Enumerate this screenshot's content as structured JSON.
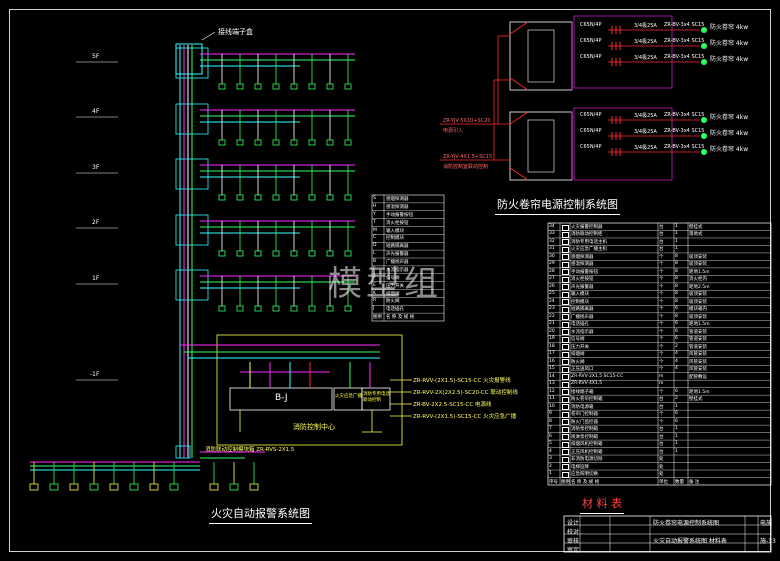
{
  "watermark": "模型组",
  "titles": {
    "fire_alarm_system": "火灾自动报警系统图",
    "fire_door_power": "防火卷帘电源控制系统图",
    "materials_table": "材 料 表"
  },
  "labels": {
    "top_riser": "接线端子盒",
    "control_center": "消防控制中心",
    "bj_box": "B-J",
    "broadcast_unit": "火灾应急广播",
    "telephone_unit": "消防专用电话 联动控制",
    "riser_bottom": "消防联动控制模块箱 ZR-RVS-2X1.5",
    "cable_1": "ZR-RVV-(2X1.5)-SC15-CC 火灾报警线",
    "cable_2": "ZR-RVV-2X(2X2.5)-SC20-CC 联动控制线",
    "cable_3": "ZR-BV-2X2.5-SC15-CC 电源线",
    "cable_4": "ZR-RVV-(2X1.5)-SC15-CC 火灾应急广播",
    "door_cable_1": "ZR-YJV-5X10+SC20",
    "door_cable_2": "ZR-YJV-4X1.5+SC15",
    "door_note_1": "电源引入",
    "door_note_2": "消防控制室联动控制"
  },
  "floors": [
    "5F",
    "4F",
    "3F",
    "2F",
    "1F",
    "-1F"
  ],
  "door_circuits": [
    {
      "breaker": "C65N/4P",
      "rating": "3/4极25A",
      "cable": "ZR-BV-3x4 SC15",
      "load": "防火卷帘 4kw"
    },
    {
      "breaker": "C65N/4P",
      "rating": "3/4极25A",
      "cable": "ZR-BV-3x4 SC15",
      "load": "防火卷帘 4kw"
    },
    {
      "breaker": "C65N/4P",
      "rating": "3/4极25A",
      "cable": "ZR-BV-3x4 SC15",
      "load": "防火卷帘 4kw"
    },
    {
      "breaker": "C65N/4P",
      "rating": "3/4极25A",
      "cable": "ZR-BV-3x4 SC15",
      "load": "防火卷帘 4kw"
    },
    {
      "breaker": "C65N/4P",
      "rating": "3/4极25A",
      "cable": "ZR-BV-3x4 SC15",
      "load": "防火卷帘 4kw"
    },
    {
      "breaker": "C65N/4P",
      "rating": "3/4极25A",
      "cable": "ZR-BV-3x4 SC15",
      "load": "防火卷帘 4kw"
    }
  ],
  "legend_rows": [
    {
      "sym": "S",
      "name": "感烟探测器"
    },
    {
      "sym": "H",
      "name": "感温探测器"
    },
    {
      "sym": "Y",
      "name": "手动报警按钮"
    },
    {
      "sym": "T",
      "name": "消火栓按钮"
    },
    {
      "sym": "M",
      "name": "输入模块"
    },
    {
      "sym": "C",
      "name": "控制模块"
    },
    {
      "sym": "D",
      "name": "短路隔离器"
    },
    {
      "sym": "L",
      "name": "声光报警器"
    },
    {
      "sym": "B",
      "name": "广播扬声器"
    },
    {
      "sym": "F",
      "name": "水流指示器"
    },
    {
      "sym": "P",
      "name": "信号阀"
    },
    {
      "sym": "E",
      "name": "压力开关"
    },
    {
      "sym": "K",
      "name": "排烟阀"
    },
    {
      "sym": "R",
      "name": "防火阀"
    },
    {
      "sym": "J",
      "name": "电话插孔"
    },
    {
      "sym": "图例",
      "name": "名 称 及 规 格"
    }
  ],
  "materials": {
    "header": [
      "序号",
      "图例",
      "名 称 及 规 格",
      "单位",
      "数量",
      "备 注"
    ],
    "rows": [
      [
        "34",
        "",
        "火灾报警控制器",
        "台",
        "1",
        "壁挂式"
      ],
      [
        "33",
        "",
        "消防联动控制柜",
        "台",
        "1",
        "落地式"
      ],
      [
        "32",
        "",
        "消防专用电话主机",
        "台",
        "1",
        ""
      ],
      [
        "31",
        "",
        "火灾应急广播主机",
        "台",
        "1",
        ""
      ],
      [
        "30",
        "",
        "感烟探测器",
        "个",
        "8",
        "吸顶安装"
      ],
      [
        "29",
        "",
        "感温探测器",
        "个",
        "8",
        "吸顶安装"
      ],
      [
        "28",
        "",
        "手动报警按钮",
        "个",
        "8",
        "距地1.5m"
      ],
      [
        "27",
        "",
        "消火栓按钮",
        "个",
        "8",
        "消火栓内"
      ],
      [
        "26",
        "",
        "声光报警器",
        "个",
        "8",
        "距地2.5m"
      ],
      [
        "25",
        "",
        "输入模块",
        "个",
        "8",
        "吸顶安装"
      ],
      [
        "24",
        "",
        "控制模块",
        "个",
        "8",
        "吸顶安装"
      ],
      [
        "23",
        "",
        "短路隔离器",
        "个",
        "6",
        "模块箱内"
      ],
      [
        "22",
        "",
        "广播扬声器",
        "个",
        "8",
        "吸顶安装"
      ],
      [
        "21",
        "",
        "电话插孔",
        "个",
        "6",
        "距地1.5m"
      ],
      [
        "20",
        "",
        "水流指示器",
        "个",
        "6",
        "管道安装"
      ],
      [
        "19",
        "",
        "信号阀",
        "个",
        "6",
        "管道安装"
      ],
      [
        "18",
        "",
        "压力开关",
        "个",
        "2",
        "管道安装"
      ],
      [
        "17",
        "",
        "排烟阀",
        "个",
        "4",
        "风管安装"
      ],
      [
        "16",
        "",
        "防火阀",
        "个",
        "4",
        "风管安装"
      ],
      [
        "15",
        "",
        "正压送风口",
        "个",
        "4",
        "风管安装"
      ],
      [
        "14",
        "",
        "ZR-RVV-2X1.5 SC15-CC",
        "m",
        "",
        "配管敷设"
      ],
      [
        "13",
        "",
        "ZR-RVV-4X1.5",
        "m",
        "",
        ""
      ],
      [
        "12",
        "",
        "接线端子箱",
        "个",
        "6",
        "距地1.5m"
      ],
      [
        "11",
        "",
        "防火卷帘控制箱",
        "台",
        "2",
        "壁挂式"
      ],
      [
        "10",
        "",
        "消防电源箱",
        "台",
        "1",
        ""
      ],
      [
        "9",
        "",
        "卷帘门控制器",
        "个",
        "6",
        ""
      ],
      [
        "8",
        "",
        "防火门监控器",
        "个",
        "6",
        ""
      ],
      [
        "7",
        "",
        "消防泵控制箱",
        "台",
        "1",
        ""
      ],
      [
        "6",
        "",
        "喷淋泵控制箱",
        "台",
        "1",
        ""
      ],
      [
        "5",
        "",
        "排烟风机控制箱",
        "台",
        "1",
        ""
      ],
      [
        "4",
        "",
        "正压风机控制箱",
        "台",
        "1",
        ""
      ],
      [
        "3",
        "",
        "非消防电源切除",
        "处",
        "",
        ""
      ],
      [
        "2",
        "",
        "电梯迫降",
        "处",
        "",
        ""
      ],
      [
        "1",
        "",
        "应急照明切换",
        "处",
        "",
        ""
      ]
    ],
    "footer": [
      "序号",
      "图例",
      "名 称 及 规 格",
      "单位",
      "数量",
      "备 注"
    ]
  },
  "title_block": {
    "project": "防火卷帘电源控制系统图",
    "drawing": "火灾自动报警系统图 材料表",
    "sheet": "电施",
    "no": "施-13",
    "row_labels": [
      "设计",
      "校对",
      "审核",
      "审定"
    ]
  },
  "colors": {
    "magenta": "#ff2cff",
    "cyan": "#30ffff",
    "green": "#30ff60",
    "yellow": "#ffff40",
    "red": "#ff2a2a",
    "white": "#ffffff"
  }
}
